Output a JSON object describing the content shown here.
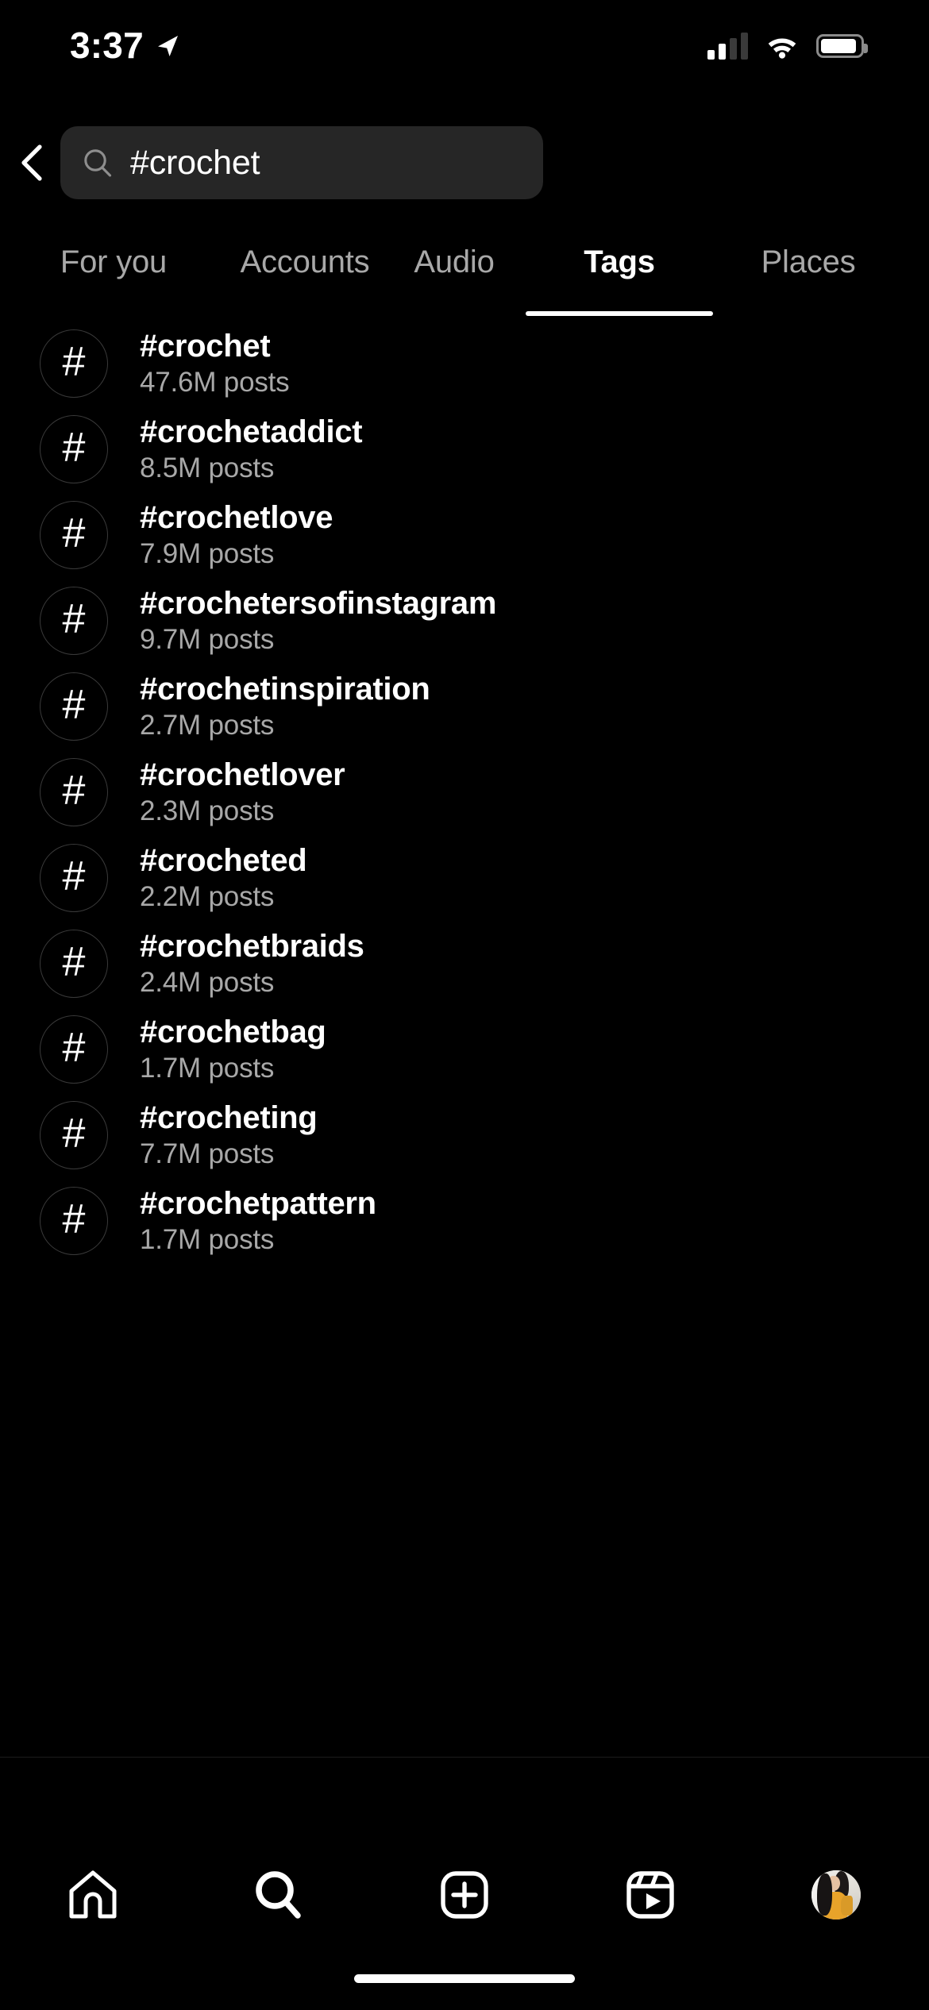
{
  "status_bar": {
    "time": "3:37",
    "location_icon": "location-arrow-icon",
    "signal_icon": "cellular-signal-icon",
    "signal_bars_filled": 2,
    "signal_bars_total": 4,
    "wifi_icon": "wifi-icon",
    "battery_icon": "battery-icon",
    "battery_level_percent": 92
  },
  "header": {
    "back_icon": "back-chevron-icon",
    "search": {
      "icon": "search-icon",
      "value": "#crochet",
      "placeholder": "Search"
    }
  },
  "tabs": {
    "active": "Tags",
    "items": [
      {
        "label": "For you",
        "active": false
      },
      {
        "label": "Accounts",
        "active": false
      },
      {
        "label": "Audio",
        "active": false
      },
      {
        "label": "Tags",
        "active": true
      },
      {
        "label": "Places",
        "active": false
      }
    ]
  },
  "results": {
    "hash_glyph": "#",
    "items": [
      {
        "tag": "#crochet",
        "count": "47.6M posts"
      },
      {
        "tag": "#crochetaddict",
        "count": "8.5M posts"
      },
      {
        "tag": "#crochetlove",
        "count": "7.9M posts"
      },
      {
        "tag": "#crochetersofinstagram",
        "count": "9.7M posts"
      },
      {
        "tag": "#crochetinspiration",
        "count": "2.7M posts"
      },
      {
        "tag": "#crochetlover",
        "count": "2.3M posts"
      },
      {
        "tag": "#crocheted",
        "count": "2.2M posts"
      },
      {
        "tag": "#crochetbraids",
        "count": "2.4M posts"
      },
      {
        "tag": "#crochetbag",
        "count": "1.7M posts"
      },
      {
        "tag": "#crocheting",
        "count": "7.7M posts"
      },
      {
        "tag": "#crochetpattern",
        "count": "1.7M posts"
      }
    ]
  },
  "tab_bar": {
    "items": [
      {
        "name": "home",
        "icon": "home-icon",
        "active": false
      },
      {
        "name": "search",
        "icon": "search-icon",
        "active": true
      },
      {
        "name": "create",
        "icon": "plus-square-icon",
        "active": false
      },
      {
        "name": "reels",
        "icon": "reels-icon",
        "active": false
      },
      {
        "name": "profile",
        "icon": "profile-avatar-icon",
        "active": false
      }
    ]
  },
  "colors": {
    "background": "#000000",
    "search_field": "#262626",
    "primary_text": "#ffffff",
    "secondary_text": "#a8a8a8",
    "avatar_border": "#3a3a3a",
    "active_underline": "#ffffff"
  }
}
